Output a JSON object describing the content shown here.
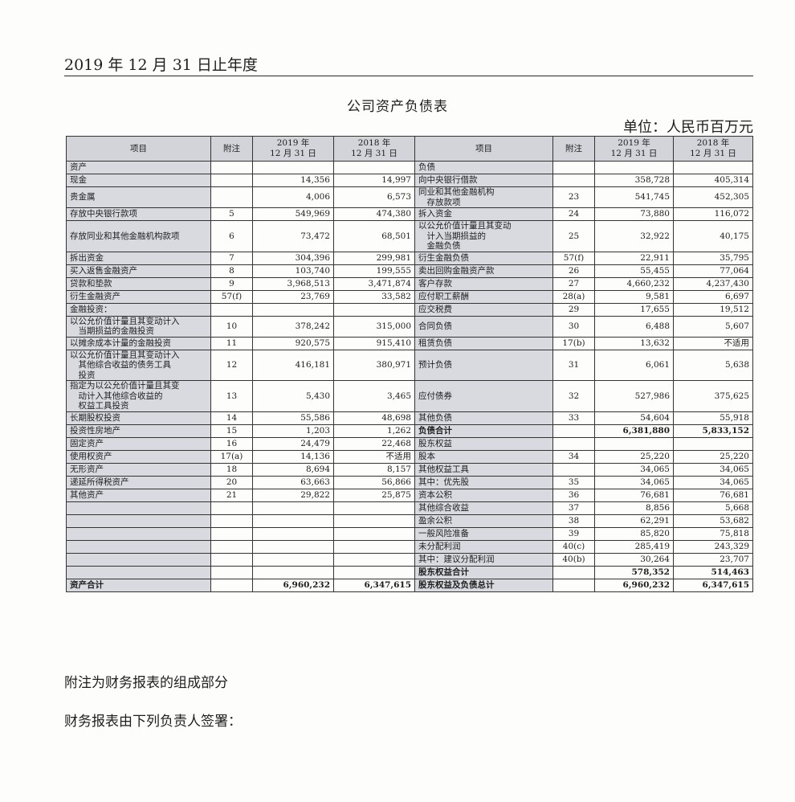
{
  "header": {
    "period": "2019 年 12 月 31 日止年度",
    "title": "公司资产负债表",
    "unit": "单位：人民币百万元"
  },
  "columns": {
    "item": "项目",
    "note": "附注",
    "y2019_line1": "2019 年",
    "y2019_line2": "12 月 31 日",
    "y2018_line1": "2018 年",
    "y2018_line2": "12 月 31 日"
  },
  "rows": [
    {
      "l": "资产",
      "ln": "",
      "l19": "",
      "l18": "",
      "r": "负债",
      "rn": "",
      "r19": "",
      "r18": ""
    },
    {
      "l": "现金",
      "ln": "",
      "l19": "14,356",
      "l18": "14,997",
      "r": "向中央银行借款",
      "rn": "",
      "r19": "358,728",
      "r18": "405,314"
    },
    {
      "l": "贵金属",
      "ln": "",
      "l19": "4,006",
      "l18": "6,573",
      "r": "同业和其他金融机构\n　存放款项",
      "rn": "23",
      "r19": "541,745",
      "r18": "452,305"
    },
    {
      "l": "存放中央银行款项",
      "ln": "5",
      "l19": "549,969",
      "l18": "474,380",
      "r": "拆入资金",
      "rn": "24",
      "r19": "73,880",
      "r18": "116,072"
    },
    {
      "l": "存放同业和其他金融机构款项",
      "ln": "6",
      "l19": "73,472",
      "l18": "68,501",
      "r": "以公允价值计量且其变动\n　计入当期损益的\n　金融负债",
      "rn": "25",
      "r19": "32,922",
      "r18": "40,175"
    },
    {
      "l": "拆出资金",
      "ln": "7",
      "l19": "304,396",
      "l18": "299,981",
      "r": "衍生金融负债",
      "rn": "57(f)",
      "r19": "22,911",
      "r18": "35,795"
    },
    {
      "l": "买入返售金融资产",
      "ln": "8",
      "l19": "103,740",
      "l18": "199,555",
      "r": "卖出回购金融资产款",
      "rn": "26",
      "r19": "55,455",
      "r18": "77,064"
    },
    {
      "l": "贷款和垫款",
      "ln": "9",
      "l19": "3,968,513",
      "l18": "3,471,874",
      "r": "客户存款",
      "rn": "27",
      "r19": "4,660,232",
      "r18": "4,237,430"
    },
    {
      "l": "衍生金融资产",
      "ln": "57(f)",
      "l19": "23,769",
      "l18": "33,582",
      "r": "应付职工薪酬",
      "rn": "28(a)",
      "r19": "9,581",
      "r18": "6,697"
    },
    {
      "l": "金融投资：",
      "ln": "",
      "l19": "",
      "l18": "",
      "r": "应交税费",
      "rn": "29",
      "r19": "17,655",
      "r18": "19,512"
    },
    {
      "l": "以公允价值计量且其变动计入\n　当期损益的金融投资",
      "ln": "10",
      "l19": "378,242",
      "l18": "315,000",
      "r": "合同负债",
      "rn": "30",
      "r19": "6,488",
      "r18": "5,607"
    },
    {
      "l": "以摊余成本计量的金融投资",
      "ln": "11",
      "l19": "920,575",
      "l18": "915,410",
      "r": "租赁负债",
      "rn": "17(b)",
      "r19": "13,632",
      "r18": "不适用"
    },
    {
      "l": "以公允价值计量且其变动计入\n　其他综合收益的债务工具\n　投资",
      "ln": "12",
      "l19": "416,181",
      "l18": "380,971",
      "r": "预计负债",
      "rn": "31",
      "r19": "6,061",
      "r18": "5,638"
    },
    {
      "l": "指定为以公允价值计量且其变\n　动计入其他综合收益的\n　权益工具投资",
      "ln": "13",
      "l19": "5,430",
      "l18": "3,465",
      "r": "应付债券",
      "rn": "32",
      "r19": "527,986",
      "r18": "375,625"
    },
    {
      "l": "长期股权投资",
      "ln": "14",
      "l19": "55,586",
      "l18": "48,698",
      "r": "其他负债",
      "rn": "33",
      "r19": "54,604",
      "r18": "55,918"
    },
    {
      "l": "投资性房地产",
      "ln": "15",
      "l19": "1,203",
      "l18": "1,262",
      "r": "负债合计",
      "rn": "",
      "r19": "6,381,880",
      "r18": "5,833,152"
    },
    {
      "l": "固定资产",
      "ln": "16",
      "l19": "24,479",
      "l18": "22,468",
      "r": "股东权益",
      "rn": "",
      "r19": "",
      "r18": ""
    },
    {
      "l": "使用权资产",
      "ln": "17(a)",
      "l19": "14,136",
      "l18": "不适用",
      "r": "股本",
      "rn": "34",
      "r19": "25,220",
      "r18": "25,220"
    },
    {
      "l": "无形资产",
      "ln": "18",
      "l19": "8,694",
      "l18": "8,157",
      "r": "其他权益工具",
      "rn": "",
      "r19": "34,065",
      "r18": "34,065"
    },
    {
      "l": "递延所得税资产",
      "ln": "20",
      "l19": "63,663",
      "l18": "56,866",
      "r": "其中：优先股",
      "rn": "35",
      "r19": "34,065",
      "r18": "34,065"
    },
    {
      "l": "其他资产",
      "ln": "21",
      "l19": "29,822",
      "l18": "25,875",
      "r": "资本公积",
      "rn": "36",
      "r19": "76,681",
      "r18": "76,681"
    },
    {
      "l": "",
      "ln": "",
      "l19": "",
      "l18": "",
      "r": "其他综合收益",
      "rn": "37",
      "r19": "8,856",
      "r18": "5,668"
    },
    {
      "l": "",
      "ln": "",
      "l19": "",
      "l18": "",
      "r": "盈余公积",
      "rn": "38",
      "r19": "62,291",
      "r18": "53,682"
    },
    {
      "l": "",
      "ln": "",
      "l19": "",
      "l18": "",
      "r": "一般风险准备",
      "rn": "39",
      "r19": "85,820",
      "r18": "75,818"
    },
    {
      "l": "",
      "ln": "",
      "l19": "",
      "l18": "",
      "r": "未分配利润",
      "rn": "40(c)",
      "r19": "285,419",
      "r18": "243,329"
    },
    {
      "l": "",
      "ln": "",
      "l19": "",
      "l18": "",
      "r": "其中：建议分配利润",
      "rn": "40(b)",
      "r19": "30,264",
      "r18": "23,707"
    },
    {
      "l": "",
      "ln": "",
      "l19": "",
      "l18": "",
      "r": "股东权益合计",
      "rn": "",
      "r19": "578,352",
      "r18": "514,463"
    },
    {
      "l": "资产合计",
      "ln": "",
      "l19": "6,960,232",
      "l18": "6,347,615",
      "r": "股东权益及负债总计",
      "rn": "",
      "r19": "6,960,232",
      "r18": "6,347,615"
    }
  ],
  "footer": {
    "note": "附注为财务报表的组成部分",
    "signature": "财务报表由下列负责人签署："
  }
}
